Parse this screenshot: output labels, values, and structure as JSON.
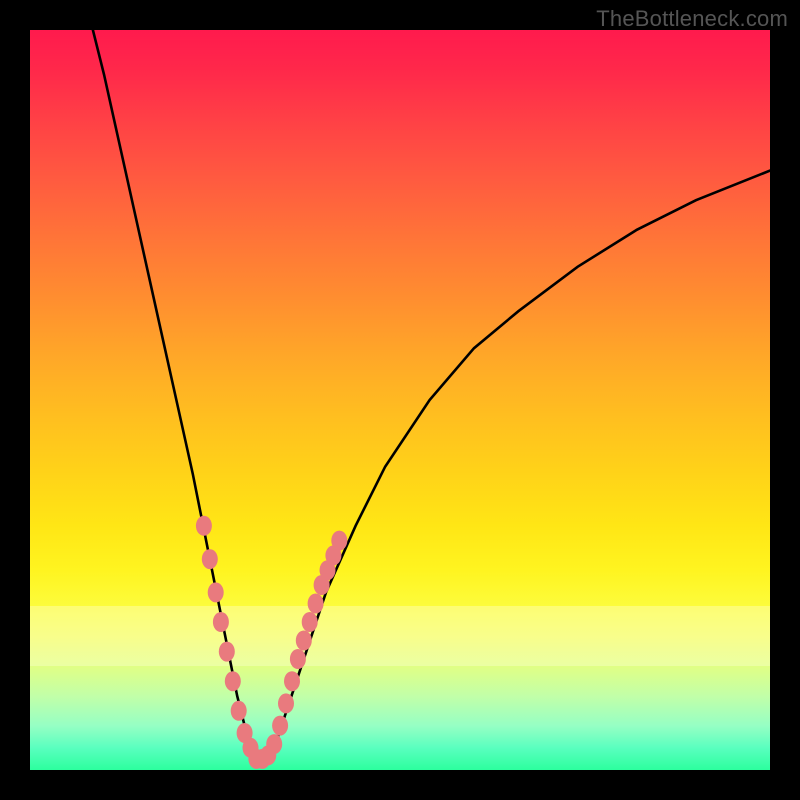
{
  "watermark": "TheBottleneck.com",
  "colors": {
    "curve": "#000000",
    "dots": "#e97a7e",
    "frame": "#000000"
  },
  "chart_data": {
    "type": "line",
    "title": "",
    "xlabel": "",
    "ylabel": "",
    "xlim": [
      0,
      100
    ],
    "ylim": [
      0,
      100
    ],
    "grid": false,
    "legend": false,
    "note": "Values are read as percentages of the plot area (x left→right, y bottom→top). The single curve is a V-shaped bottleneck profile.",
    "series": [
      {
        "name": "bottleneck-curve",
        "x": [
          8.5,
          10,
          12,
          14,
          16,
          18,
          20,
          22,
          24,
          26,
          27,
          28,
          29,
          30,
          31,
          32,
          33,
          34,
          36,
          38,
          40,
          44,
          48,
          54,
          60,
          66,
          74,
          82,
          90,
          100
        ],
        "y": [
          100,
          94,
          85,
          76,
          67,
          58,
          49,
          40,
          30,
          20,
          15,
          10,
          6,
          3,
          1.5,
          1.5,
          3,
          6,
          12,
          18,
          24,
          33,
          41,
          50,
          57,
          62,
          68,
          73,
          77,
          81
        ]
      }
    ],
    "marker_points": {
      "name": "highlighted-range-dots",
      "color": "#e97a7e",
      "x": [
        23.5,
        24.3,
        25.1,
        25.8,
        26.6,
        27.4,
        28.2,
        29,
        29.8,
        30.6,
        31.4,
        32.2,
        33,
        33.8,
        34.6,
        35.4,
        36.2,
        37,
        37.8,
        38.6,
        39.4,
        40.2,
        41,
        41.8
      ],
      "y": [
        33,
        28.5,
        24,
        20,
        16,
        12,
        8,
        5,
        3,
        1.5,
        1.5,
        2,
        3.5,
        6,
        9,
        12,
        15,
        17.5,
        20,
        22.5,
        25,
        27,
        29,
        31
      ]
    }
  }
}
